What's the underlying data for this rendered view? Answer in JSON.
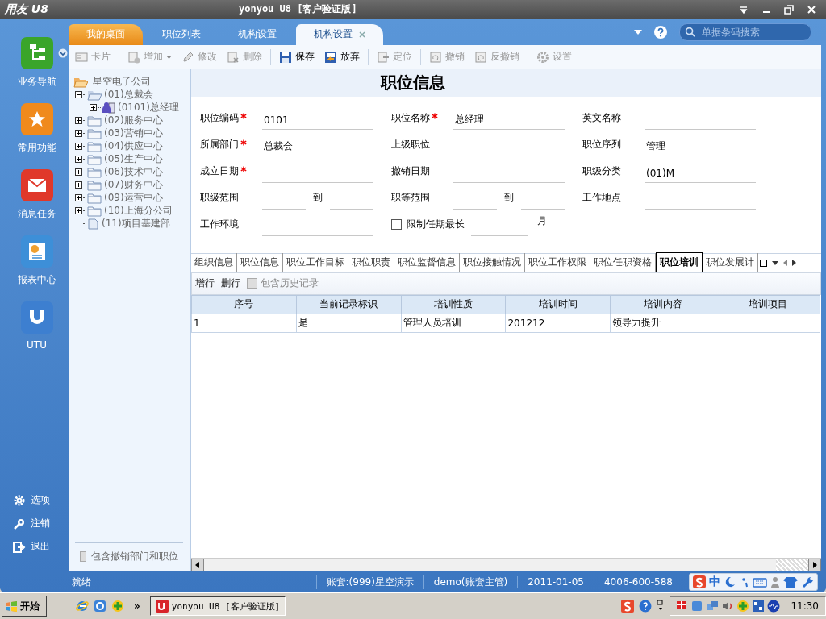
{
  "title_bar": {
    "logo": "用友 U8",
    "title": "yonyou U8 [客户验证版]"
  },
  "nav": {
    "items": [
      {
        "label": "业务导航",
        "color": "#3aa52a"
      },
      {
        "label": "常用功能",
        "color": "#f08a1c"
      },
      {
        "label": "消息任务",
        "color": "#e0382a"
      },
      {
        "label": "报表中心",
        "color": "#3d8fd8"
      },
      {
        "label": "UTU",
        "color": "#3d7fd0"
      }
    ],
    "bottom_items": [
      {
        "label": "选项",
        "kind": "gear"
      },
      {
        "label": "注销",
        "kind": "key"
      },
      {
        "label": "退出",
        "kind": "exit"
      }
    ]
  },
  "tabs": [
    {
      "label": "我的桌面",
      "selected": false,
      "kind": "home"
    },
    {
      "label": "职位列表",
      "selected": false,
      "kind": "plain"
    },
    {
      "label": "机构设置",
      "selected": false,
      "kind": "plain"
    },
    {
      "label": "机构设置",
      "selected": true,
      "kind": "plain"
    }
  ],
  "search": {
    "placeholder": "单据条码搜索"
  },
  "toolbar": [
    {
      "label": "卡片",
      "disabled": true,
      "caret": false
    },
    {
      "label": "增加",
      "disabled": true,
      "caret": true
    },
    {
      "label": "修改",
      "disabled": true,
      "caret": false
    },
    {
      "label": "删除",
      "disabled": true,
      "caret": false
    },
    {
      "label": "保存",
      "disabled": false,
      "caret": false
    },
    {
      "label": "放弃",
      "disabled": false,
      "caret": false
    },
    {
      "label": "定位",
      "disabled": true,
      "caret": false
    },
    {
      "label": "撤销",
      "disabled": true,
      "caret": false
    },
    {
      "label": "反撤销",
      "disabled": true,
      "caret": false
    },
    {
      "label": "设置",
      "disabled": true,
      "caret": false
    }
  ],
  "tree": {
    "root": "星空电子公司",
    "children": [
      {
        "label": "(01)总裁会",
        "kind": "folder",
        "expanded": true,
        "children": [
          {
            "label": "(0101)总经理",
            "kind": "person",
            "expanded": false
          }
        ]
      },
      {
        "label": "(02)服务中心",
        "kind": "folder",
        "expanded": false
      },
      {
        "label": "(03)营销中心",
        "kind": "folder",
        "expanded": false
      },
      {
        "label": "(04)供应中心",
        "kind": "folder",
        "expanded": false
      },
      {
        "label": "(05)生产中心",
        "kind": "folder",
        "expanded": false
      },
      {
        "label": "(06)技术中心",
        "kind": "folder",
        "expanded": false
      },
      {
        "label": "(07)财务中心",
        "kind": "folder",
        "expanded": false
      },
      {
        "label": "(09)运营中心",
        "kind": "folder",
        "expanded": false
      },
      {
        "label": "(10)上海分公司",
        "kind": "folder",
        "expanded": false
      },
      {
        "label": "(11)项目基建部",
        "kind": "doc"
      }
    ],
    "footer": {
      "label": "包含撤销部门和职位",
      "checked": false
    }
  },
  "form": {
    "title": "职位信息",
    "rows": [
      [
        {
          "kind": "text",
          "label": "职位编码",
          "required": true,
          "value": "0101"
        },
        {
          "kind": "text",
          "label": "职位名称",
          "required": true,
          "value": "总经理"
        },
        {
          "kind": "text",
          "label": "英文名称",
          "required": false
        }
      ],
      [
        {
          "kind": "text",
          "label": "所属部门",
          "required": true,
          "value": "总裁会"
        },
        {
          "kind": "text",
          "label": "上级职位",
          "required": false
        },
        {
          "kind": "text",
          "label": "职位序列",
          "required": false,
          "value": "管理"
        }
      ],
      [
        {
          "kind": "text",
          "label": "成立日期",
          "required": true
        },
        {
          "kind": "text",
          "label": "撤销日期",
          "required": false
        },
        {
          "kind": "text",
          "label": "职级分类",
          "required": false,
          "value": "(01)M"
        }
      ],
      [
        {
          "kind": "range",
          "label": "职级范围",
          "to": "到"
        },
        {
          "kind": "range",
          "label": "职等范围",
          "to": "到"
        },
        {
          "kind": "text",
          "label": "工作地点",
          "required": false
        }
      ],
      [
        {
          "kind": "text",
          "label": "工作环境",
          "required": false
        },
        {
          "kind": "check",
          "label": "限制任期最长",
          "checked": false,
          "unit": "月"
        }
      ]
    ]
  },
  "detail_tabs": [
    {
      "label": "组织信息",
      "selected": false
    },
    {
      "label": "职位信息",
      "selected": false
    },
    {
      "label": "职位工作目标",
      "selected": false
    },
    {
      "label": "职位职责",
      "selected": false
    },
    {
      "label": "职位监督信息",
      "selected": false
    },
    {
      "label": "职位接触情况",
      "selected": false
    },
    {
      "label": "职位工作权限",
      "selected": false
    },
    {
      "label": "职位任职资格",
      "selected": false
    },
    {
      "label": "职位培训",
      "selected": true
    },
    {
      "label": "职位发展计",
      "selected": false
    }
  ],
  "detail_toolbar": {
    "buttons": [
      "增行",
      "删行"
    ],
    "history": {
      "label": "包含历史记录",
      "checked": false
    }
  },
  "table": {
    "columns": [
      "序号",
      "当前记录标识",
      "培训性质",
      "培训时间",
      "培训内容",
      "培训项目"
    ],
    "rows": [
      [
        "1",
        "是",
        "管理人员培训",
        "201212",
        "领导力提升",
        ""
      ]
    ]
  },
  "status_bar": [
    "就绪",
    "账套:(999)星空演示",
    "demo(账套主管)",
    "2011-01-05",
    "4006-600-588"
  ],
  "ime": {
    "label": "中"
  },
  "taskbar": {
    "start": "开始",
    "more": "»",
    "window": "yonyou U8 [客户验证版]",
    "clock": "11:30"
  }
}
